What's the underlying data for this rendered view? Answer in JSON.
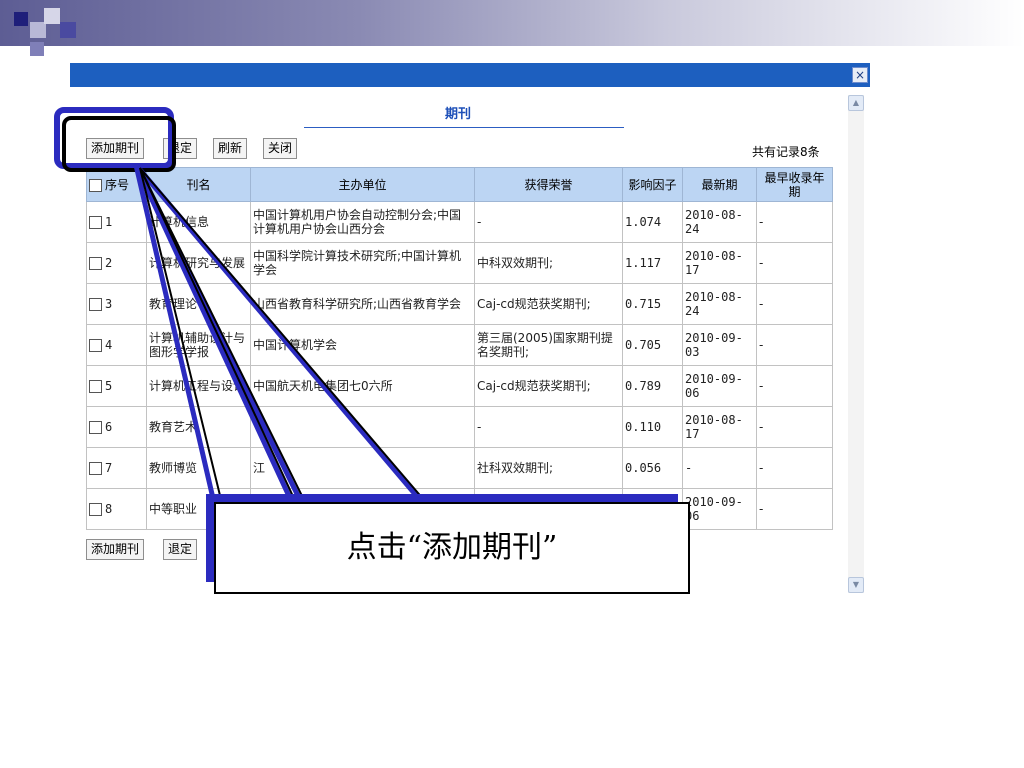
{
  "dialog": {
    "title": "期刊",
    "close_label": "×",
    "record_count": "共有记录8条"
  },
  "toolbar_top": {
    "add": "添加期刊",
    "cancel": "退定",
    "refresh": "刷新",
    "close": "关闭"
  },
  "toolbar_bottom": {
    "add": "添加期刊",
    "cancel": "退定"
  },
  "table": {
    "headers": [
      "序号",
      "刊名",
      "主办单位",
      "获得荣誉",
      "影响因子",
      "最新期",
      "最早收录年期"
    ],
    "rows": [
      {
        "no": "1",
        "name": "计算机信息",
        "org": "中国计算机用户协会自动控制分会;中国计算机用户协会山西分会",
        "honor": "-",
        "factor": "1.074",
        "latest": "2010-08-24",
        "earliest": "-"
      },
      {
        "no": "2",
        "name": "计算机研究与发展",
        "org": "中国科学院计算技术研究所;中国计算机学会",
        "honor": "中科双效期刊;",
        "factor": "1.117",
        "latest": "2010-08-17",
        "earliest": "-"
      },
      {
        "no": "3",
        "name": "教育理论",
        "org": "山西省教育科学研究所;山西省教育学会",
        "honor": "Caj-cd规范获奖期刊;",
        "factor": "0.715",
        "latest": "2010-08-24",
        "earliest": "-"
      },
      {
        "no": "4",
        "name": "计算机辅助设计与图形学学报",
        "org": "中国计算机学会",
        "honor": "第三届(2005)国家期刊提名奖期刊;",
        "factor": "0.705",
        "latest": "2010-09-03",
        "earliest": "-"
      },
      {
        "no": "5",
        "name": "计算机工程与设计",
        "org": "中国航天机电集团七0六所",
        "honor": "Caj-cd规范获奖期刊;",
        "factor": "0.789",
        "latest": "2010-09-06",
        "earliest": "-"
      },
      {
        "no": "6",
        "name": "教育艺术",
        "org": "",
        "honor": "-",
        "factor": "0.110",
        "latest": "2010-08-17",
        "earliest": "-"
      },
      {
        "no": "7",
        "name": "教师博览",
        "org": "江",
        "honor": "社科双效期刊;",
        "factor": "0.056",
        "latest": "-",
        "earliest": "-"
      },
      {
        "no": "8",
        "name": "中等职业",
        "org": "",
        "honor": "",
        "factor": "",
        "latest": "2010-09-06",
        "earliest": "-"
      }
    ]
  },
  "annotation": {
    "callout_text": "点击“添加期刊”"
  },
  "colors": {
    "title_bar": "#1d5fbf",
    "header_bg": "#bcd5f3",
    "highlight": "#2b2bbf"
  }
}
